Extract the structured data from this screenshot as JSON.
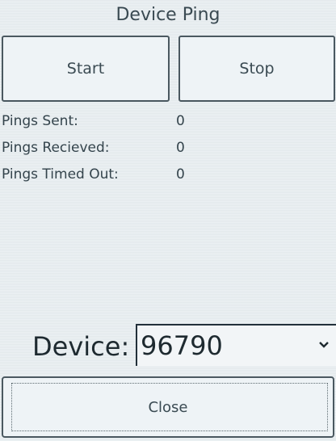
{
  "window": {
    "title": "Device Ping"
  },
  "controls": {
    "start_label": "Start",
    "stop_label": "Stop",
    "close_label": "Close"
  },
  "stats": [
    {
      "label": "Pings Sent:",
      "value": "0"
    },
    {
      "label": "Pings Recieved:",
      "value": "0"
    },
    {
      "label": "Pings Timed Out:",
      "value": "0"
    }
  ],
  "device": {
    "label": "Device:",
    "selected": "96790",
    "dropdown_icon": "chevron-down-icon"
  }
}
